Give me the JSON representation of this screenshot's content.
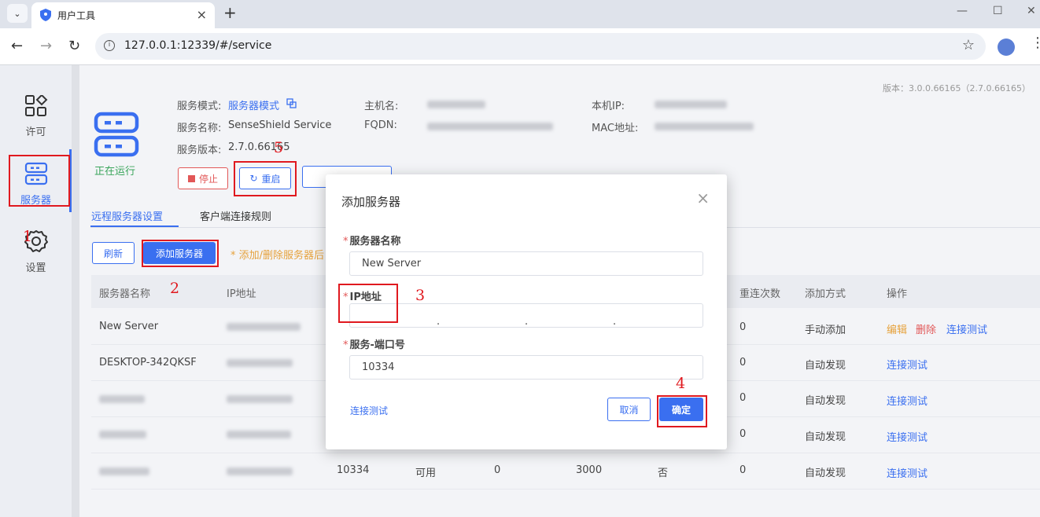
{
  "browser": {
    "tab_title": "用户工具",
    "url": "127.0.0.1:12339/#/service"
  },
  "sidebar": {
    "items": [
      {
        "label": "许可",
        "icon": "grid-icon"
      },
      {
        "label": "服务器",
        "icon": "server-icon"
      },
      {
        "label": "设置",
        "icon": "gear-icon"
      }
    ],
    "active": "服务器"
  },
  "header": {
    "version": "版本：3.0.0.66165（2.7.0.66165）",
    "status": "正在运行",
    "service_mode_label": "服务模式:",
    "service_mode_value": "服务器模式",
    "service_name_label": "服务名称:",
    "service_name_value": "SenseShield Service",
    "service_version_label": "服务版本:",
    "service_version_value": "2.7.0.66165",
    "hostname_label": "主机名:",
    "fqdn_label": "FQDN:",
    "local_ip_label": "本机IP:",
    "mac_label": "MAC地址:",
    "stop_label": "停止",
    "restart_label": "重启"
  },
  "tabs": [
    {
      "label": "远程服务器设置",
      "active": true
    },
    {
      "label": "客户端连接规则",
      "active": false
    }
  ],
  "actions": {
    "refresh_label": "刷新",
    "add_server_label": "添加服务器",
    "hint": "* 添加/删除服务器后"
  },
  "table": {
    "columns": [
      "服务器名称",
      "IP地址",
      "重连次数",
      "添加方式",
      "操作"
    ],
    "rows": [
      {
        "name": "New Server",
        "reconnect": "0",
        "method": "手动添加",
        "ops": [
          "编辑",
          "删除",
          "连接测试"
        ]
      },
      {
        "name": "DESKTOP-342QKSF",
        "reconnect": "0",
        "method": "自动发现",
        "ops": [
          "连接测试"
        ]
      },
      {
        "name": "",
        "reconnect": "0",
        "method": "自动发现",
        "ops": [
          "连接测试"
        ]
      },
      {
        "name": "",
        "reconnect": "0",
        "method": "自动发现",
        "ops": [
          "连接测试"
        ]
      },
      {
        "name": "",
        "port": "10334",
        "state": "可用",
        "col_a": "0",
        "col_b": "3000",
        "col_c": "否",
        "reconnect": "0",
        "method": "自动发现",
        "ops": [
          "连接测试"
        ]
      }
    ]
  },
  "modal": {
    "title": "添加服务器",
    "name_label": "服务器名称",
    "name_value": "New Server",
    "ip_label": "IP地址",
    "ip_dots": ".",
    "port_label": "服务-端口号",
    "port_value": "10334",
    "test_label": "连接测试",
    "cancel_label": "取消",
    "ok_label": "确定"
  },
  "annotations": [
    "1",
    "2",
    "3",
    "4",
    "5"
  ],
  "colors": {
    "accent": "#3a6ff0",
    "annotation": "#e0191f",
    "running": "#3aa55b",
    "danger": "#e25757",
    "warning": "#e6a23c"
  }
}
